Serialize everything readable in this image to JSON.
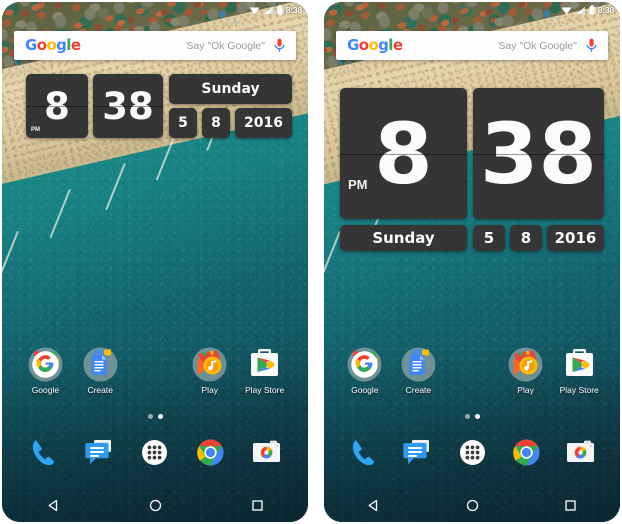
{
  "page": {
    "background_color": "#ffffff",
    "phone_count": 2
  },
  "status_bar": {
    "clock": "8:38",
    "icons": [
      "wifi-icon",
      "signal-icon",
      "battery-icon"
    ]
  },
  "search": {
    "logo_letters": [
      "G",
      "o",
      "o",
      "g",
      "l",
      "e"
    ],
    "hint": "Say \"Ok Google\"",
    "mic_icon": "microphone-icon"
  },
  "clock_widget": {
    "hour": "8",
    "minute": "38",
    "ampm": "PM",
    "weekday": "Sunday",
    "day": "5",
    "month": "8",
    "year": "2016",
    "tile_color": "#353535",
    "text_color": "#fbfbfb"
  },
  "apps": [
    {
      "label": "Google",
      "icon": "google-app-icon"
    },
    {
      "label": "Create",
      "icon": "google-docs-icon"
    },
    {
      "label": "",
      "icon": "empty-slot"
    },
    {
      "label": "Play",
      "icon": "play-music-icon"
    },
    {
      "label": "Play Store",
      "icon": "play-store-icon"
    }
  ],
  "page_dots": {
    "count": 2,
    "active_index": 1
  },
  "dock": [
    {
      "icon": "phone-icon",
      "label": "Phone"
    },
    {
      "icon": "messages-icon",
      "label": "Messages"
    },
    {
      "icon": "app-drawer-icon",
      "label": "Apps"
    },
    {
      "icon": "chrome-icon",
      "label": "Chrome"
    },
    {
      "icon": "camera-icon",
      "label": "Camera"
    }
  ],
  "nav_bar": [
    {
      "icon": "back-nav-icon",
      "label": "Back"
    },
    {
      "icon": "home-nav-icon",
      "label": "Home"
    },
    {
      "icon": "recents-nav-icon",
      "label": "Recents"
    }
  ],
  "colors": {
    "google_blue": "#4285F4",
    "google_red": "#EA4335",
    "google_yellow": "#FBBC05",
    "google_green": "#34A853",
    "widget_dark": "#353535",
    "search_bar": "#fdfdfd"
  }
}
